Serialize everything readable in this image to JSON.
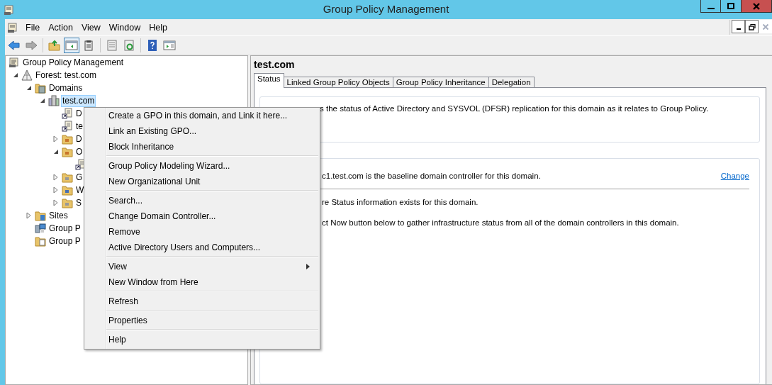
{
  "window": {
    "title": "Group Policy Management"
  },
  "menu_bar": [
    {
      "label": "File"
    },
    {
      "label": "Action"
    },
    {
      "label": "View"
    },
    {
      "label": "Window"
    },
    {
      "label": "Help"
    }
  ],
  "toolbar": [
    [
      {
        "kind": "back",
        "disabled": false,
        "pressed": false
      },
      {
        "kind": "forward",
        "disabled": true,
        "pressed": false
      }
    ],
    [
      {
        "kind": "up",
        "disabled": false,
        "pressed": false
      },
      {
        "kind": "tree-toggle",
        "disabled": false,
        "pressed": true
      },
      {
        "kind": "clipboard",
        "disabled": false,
        "pressed": false
      }
    ],
    [
      {
        "kind": "properties",
        "disabled": false,
        "pressed": false
      },
      {
        "kind": "refresh",
        "disabled": false,
        "pressed": false
      }
    ],
    [
      {
        "kind": "help",
        "disabled": false,
        "pressed": false
      },
      {
        "kind": "console",
        "disabled": false,
        "pressed": false
      }
    ]
  ],
  "tree": [
    {
      "label": "Group Policy Management",
      "kind": "console",
      "selected": false,
      "children": [
        {
          "label": "Forest: test.com",
          "kind": "forest",
          "expanded": true,
          "selected": false,
          "children": [
            {
              "label": "Domains",
              "kind": "domains",
              "expanded": true,
              "selected": false,
              "children": [
                {
                  "label": "test.com",
                  "kind": "domain",
                  "expanded": true,
                  "selected": true,
                  "children": [
                    {
                      "label": "D",
                      "kind": "gpo-link",
                      "selected": false
                    },
                    {
                      "label": "te",
                      "kind": "gpo-link",
                      "selected": false
                    },
                    {
                      "label": "D",
                      "kind": "ou",
                      "expanded": false,
                      "selected": false
                    },
                    {
                      "label": "O",
                      "kind": "ou",
                      "expanded": true,
                      "selected": false,
                      "children": [
                        {
                          "kind": "gpo-link",
                          "selected": false
                        }
                      ]
                    },
                    {
                      "label": "G",
                      "kind": "gpo-folder",
                      "expanded": false,
                      "selected": false
                    },
                    {
                      "label": "W",
                      "kind": "wmi-folder",
                      "expanded": false,
                      "selected": false
                    },
                    {
                      "label": "S",
                      "kind": "starter-folder",
                      "expanded": false,
                      "selected": false
                    }
                  ]
                }
              ]
            },
            {
              "label": "Sites",
              "kind": "sites",
              "expanded": false,
              "selected": false
            },
            {
              "label": "Group P",
              "kind": "modeling",
              "selected": false
            },
            {
              "label": "Group P",
              "kind": "results",
              "selected": false
            }
          ]
        }
      ]
    }
  ],
  "details": {
    "title": "test.com",
    "tabs": [
      {
        "label": "Status",
        "selected": true
      },
      {
        "label": "Linked Group Policy Objects",
        "selected": false
      },
      {
        "label": "Group Policy Inheritance",
        "selected": false
      },
      {
        "label": "Delegation",
        "selected": false
      }
    ],
    "status_note": "s the status of Active Directory and SYSVOL (DFSR) replication for this domain as it relates to Group Policy.",
    "baseline": {
      "text": "c1.test.com is the baseline domain controller for this domain.",
      "link": "Change"
    },
    "messages": [
      "re Status information exists for this domain.",
      "ct Now button below to gather infrastructure status from all of the domain controllers in this domain."
    ]
  },
  "context_menu": {
    "groups": [
      [
        {
          "label": "Create a GPO in this domain, and Link it here...",
          "submenu": false
        },
        {
          "label": "Link an Existing GPO...",
          "submenu": false
        },
        {
          "label": "Block Inheritance",
          "submenu": false
        }
      ],
      [
        {
          "label": "Group Policy Modeling Wizard...",
          "submenu": false
        },
        {
          "label": "New Organizational Unit",
          "submenu": false
        }
      ],
      [
        {
          "label": "Search...",
          "submenu": false
        },
        {
          "label": "Change Domain Controller...",
          "submenu": false
        },
        {
          "label": "Remove",
          "submenu": false
        },
        {
          "label": "Active Directory Users and Computers...",
          "submenu": false
        }
      ],
      [
        {
          "label": "View",
          "submenu": true
        },
        {
          "label": "New Window from Here",
          "submenu": false
        }
      ],
      [
        {
          "label": "Refresh",
          "submenu": false
        }
      ],
      [
        {
          "label": "Properties",
          "submenu": false
        }
      ],
      [
        {
          "label": "Help",
          "submenu": false
        }
      ]
    ]
  }
}
